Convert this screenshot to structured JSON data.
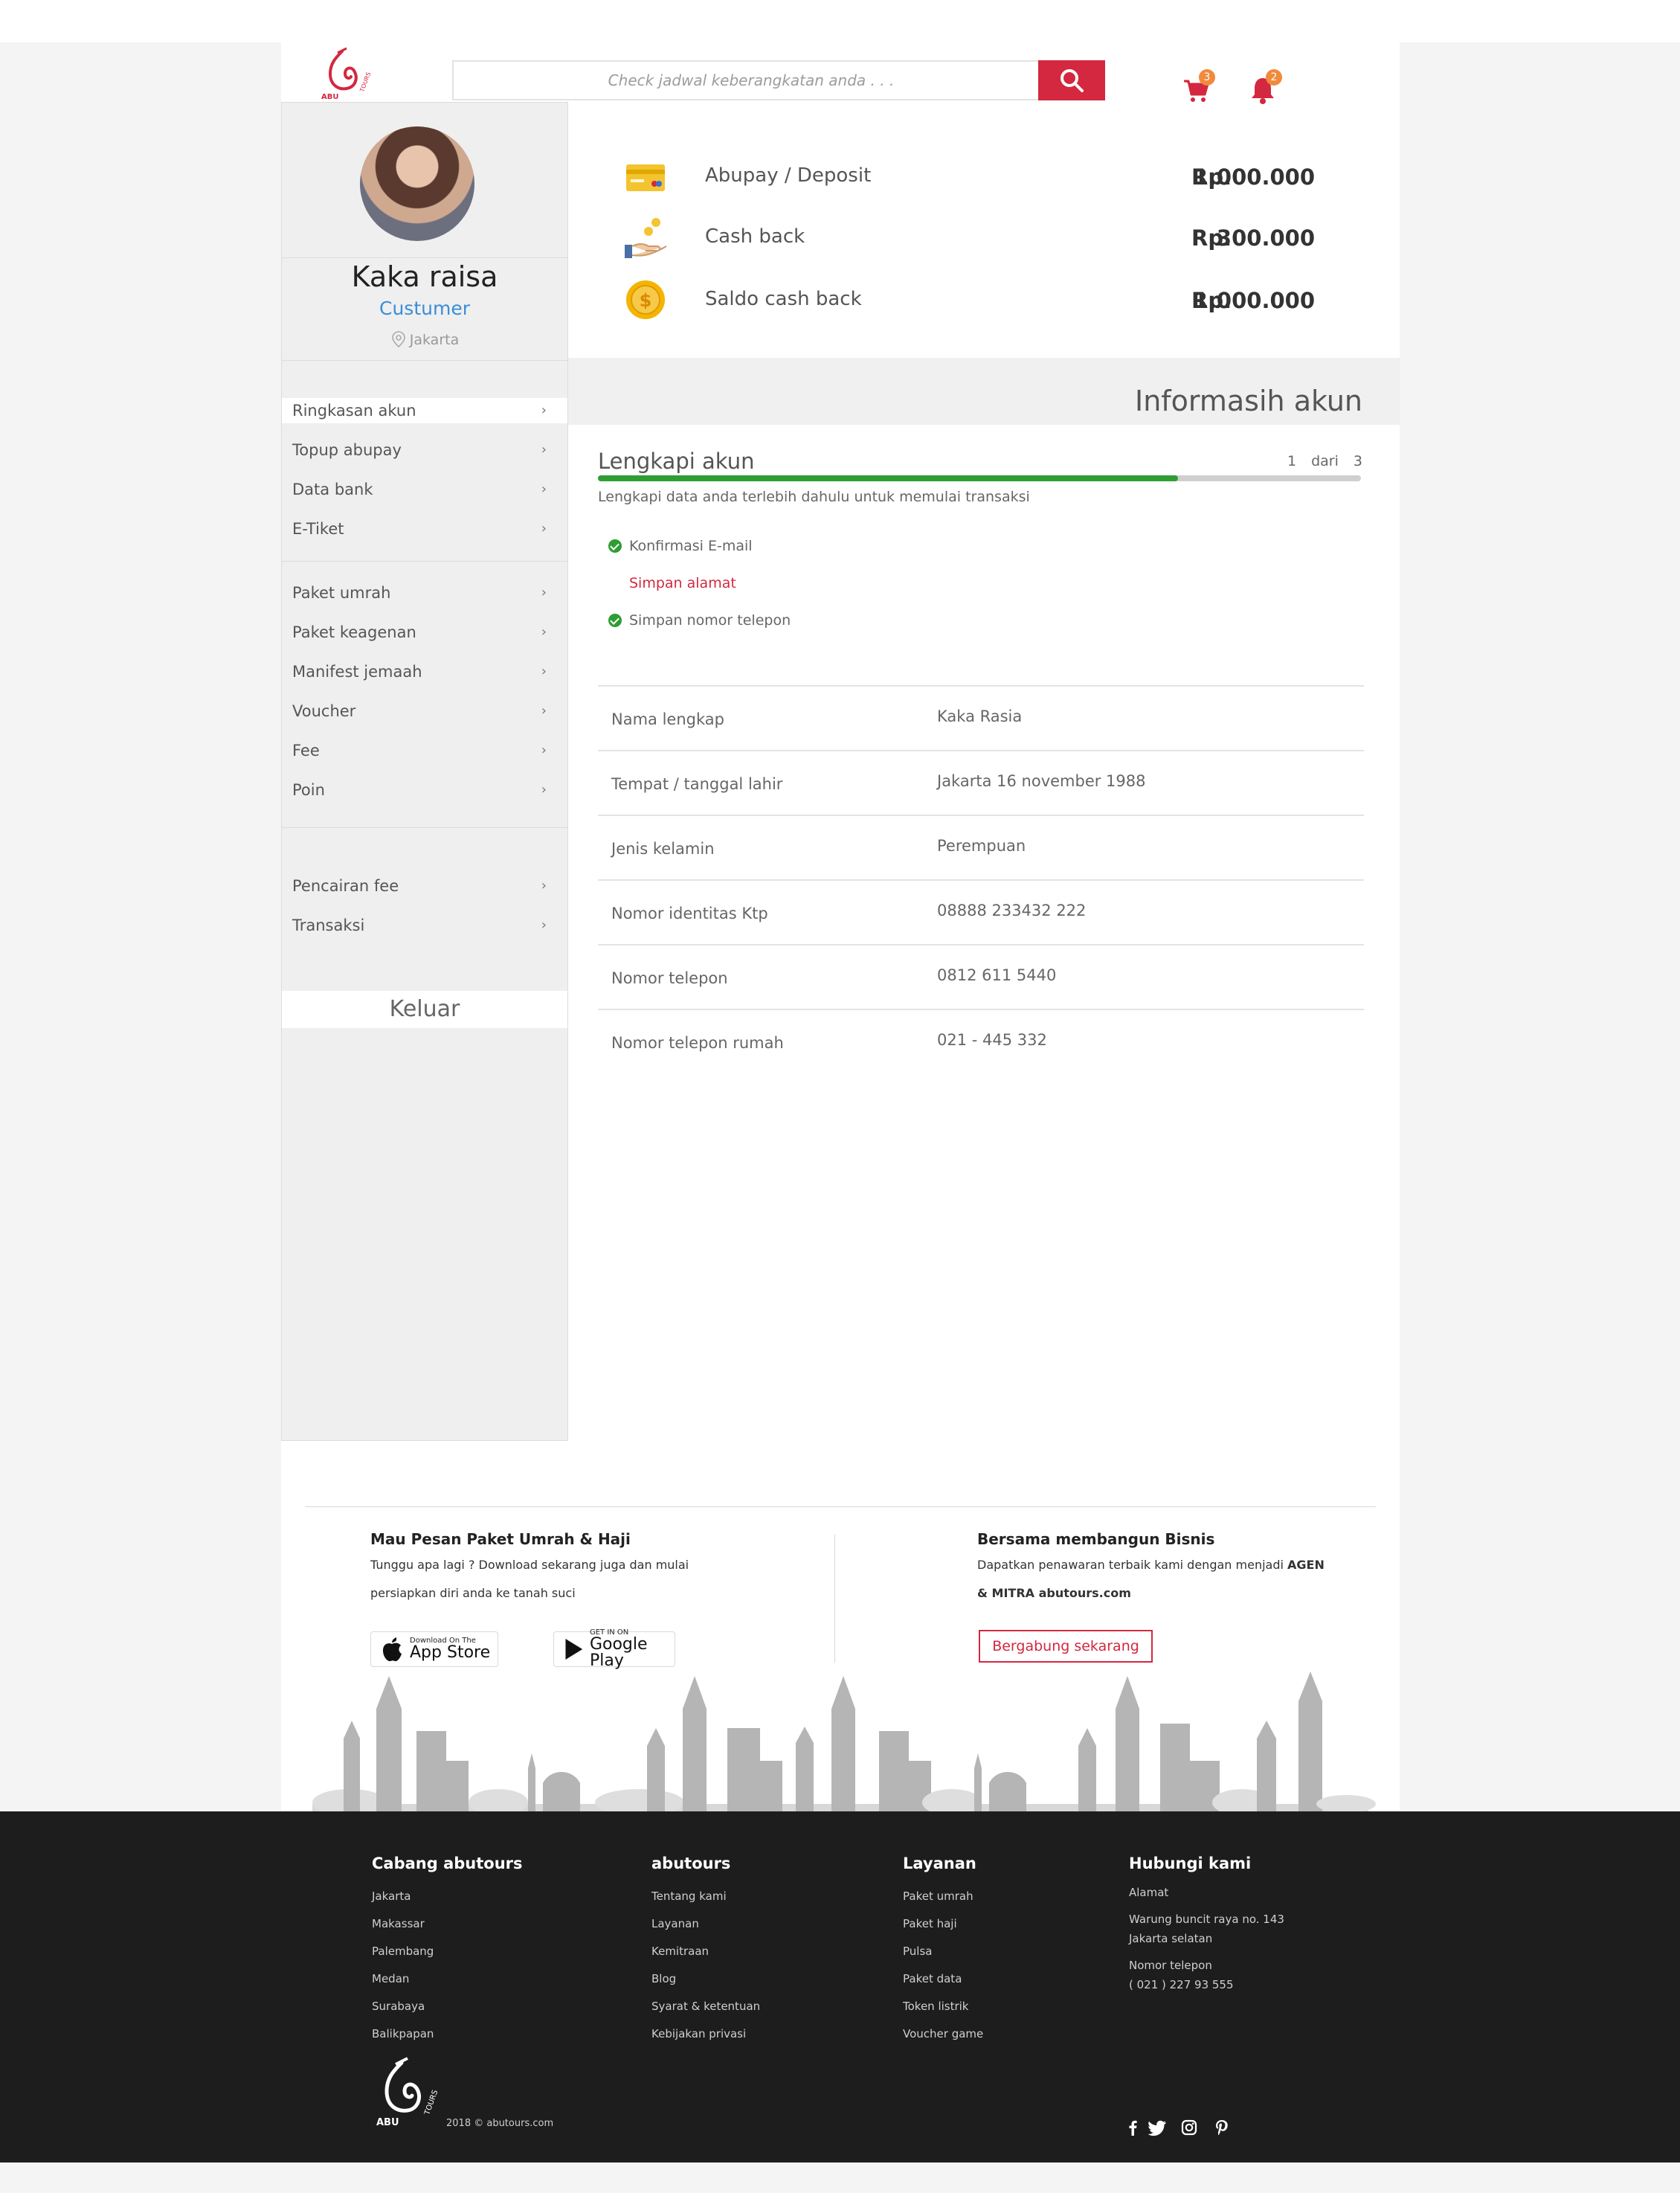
{
  "header": {
    "search_placeholder": "Check jadwal keberangkatan anda . . .",
    "cart_count": "3",
    "notif_count": "2",
    "logo_text": "ABUTOURS"
  },
  "profile": {
    "name": "Kaka raisa",
    "role": "Custumer",
    "location": "Jakarta"
  },
  "sidebar": {
    "group1": [
      {
        "label": "Ringkasan akun",
        "active": true
      },
      {
        "label": "Topup abupay"
      },
      {
        "label": "Data bank"
      },
      {
        "label": "E-Tiket"
      }
    ],
    "group2": [
      {
        "label": "Paket umrah"
      },
      {
        "label": "Paket keagenan"
      },
      {
        "label": "Manifest jemaah"
      },
      {
        "label": "Voucher"
      },
      {
        "label": "Fee"
      },
      {
        "label": "Poin"
      }
    ],
    "group3": [
      {
        "label": "Pencairan fee"
      },
      {
        "label": "Transaksi"
      }
    ],
    "logout": "Keluar",
    "chevron": "›"
  },
  "balances": [
    {
      "label": "Abupay / Deposit",
      "currency": "Rp.",
      "amount": "1.000.000",
      "icon": "card-icon"
    },
    {
      "label": "Cash back",
      "currency": "Rp.",
      "amount": "300.000",
      "icon": "hand-coin-icon"
    },
    {
      "label": "Saldo cash back",
      "currency": "Rp.",
      "amount": "1.000.000",
      "icon": "coin-icon"
    }
  ],
  "account": {
    "section_title": "Informasih akun",
    "progress_title": "Lengkapi akun",
    "progress_count": "1 dari 3",
    "progress_fraction": 0.76,
    "progress_desc": "Lengkapi data anda terlebih dahulu untuk memulai transaksi",
    "checks": [
      {
        "label": "Konfirmasi E-mail",
        "done": true
      },
      {
        "label": "Simpan alamat",
        "done": false
      },
      {
        "label": "Simpan nomor telepon",
        "done": true
      }
    ],
    "fields": [
      {
        "label": "Nama lengkap",
        "value": "Kaka Rasia"
      },
      {
        "label": "Tempat / tanggal lahir",
        "value": "Jakarta 16 november 1988"
      },
      {
        "label": "Jenis kelamin",
        "value": "Perempuan"
      },
      {
        "label": "Nomor identitas Ktp",
        "value": "08888 233432 222"
      },
      {
        "label": "Nomor telepon",
        "value": "0812 611 5440"
      },
      {
        "label": "Nomor telepon rumah",
        "value": "021 - 445 332"
      }
    ]
  },
  "promo": {
    "left_title": "Mau Pesan Paket Umrah & Haji",
    "left_text_1": "Tunggu apa lagi ? Download sekarang juga dan mulai",
    "left_text_2": "persiapkan diri anda ke tanah suci",
    "appstore_small": "Download On The",
    "appstore_big": "App Store",
    "googleplay_small": "GET IN ON",
    "googleplay_big": "Google Play",
    "right_title": "Bersama membangun Bisnis",
    "right_text_1": "Dapatkan penawaran terbaik kami dengan menjadi",
    "right_text_1_bold": "AGEN",
    "right_text_2_bold": "& MITRA abutours.com",
    "join_button": "Bergabung sekarang"
  },
  "footer": {
    "col1": {
      "title": "Cabang abutours",
      "links": [
        "Jakarta",
        "Makassar",
        "Palembang",
        "Medan",
        "Surabaya",
        "Balikpapan"
      ]
    },
    "col2": {
      "title": "abutours",
      "links": [
        "Tentang kami",
        "Layanan",
        "Kemitraan",
        "Blog",
        "Syarat & ketentuan",
        "Kebijakan privasi"
      ]
    },
    "col3": {
      "title": "Layanan",
      "links": [
        "Paket umrah",
        "Paket haji",
        "Pulsa",
        "Paket data",
        "Token listrik",
        "Voucher game"
      ]
    },
    "col4": {
      "title": "Hubungi kami",
      "address_label": "Alamat",
      "address_1": "Warung buncit raya no. 143",
      "address_2": "Jakarta selatan",
      "phone_label": "Nomor telepon",
      "phone": "( 021 )  227 93 555"
    },
    "copyright": "2018 © abutours.com",
    "social": [
      "facebook-icon",
      "twitter-icon",
      "instagram-icon",
      "pinterest-icon"
    ]
  },
  "colors": {
    "accent": "#d3283f",
    "link_blue": "#3a8ed8",
    "success": "#2e9e33",
    "badge": "#f08a3c",
    "footer_bg": "#1d1d1d"
  }
}
